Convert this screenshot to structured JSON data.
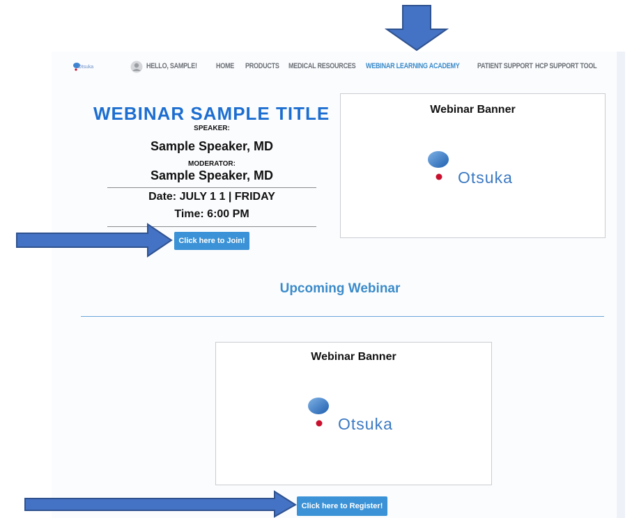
{
  "nav": {
    "brand": "Otsuka",
    "greeting": "HELLO, SAMPLE!",
    "items": [
      {
        "label": "HOME",
        "active": false
      },
      {
        "label": "PRODUCTS",
        "active": false
      },
      {
        "label": "MEDICAL RESOURCES",
        "active": false
      },
      {
        "label": "WEBINAR LEARNING ACADEMY",
        "active": true
      },
      {
        "label": "PATIENT SUPPORT",
        "active": false
      },
      {
        "label": "HCP SUPPORT TOOL",
        "active": false
      }
    ]
  },
  "event": {
    "title": "WEBINAR SAMPLE TITLE",
    "speaker_label": "SPEAKER:",
    "speaker_name": "Sample Speaker, MD",
    "moderator_label": "MODERATOR:",
    "moderator_name": "Sample Speaker, MD",
    "date": "Date: JULY 1 1 | FRIDAY",
    "time": "Time: 6:00 PM",
    "join_button": "Click here to Join!",
    "banner_title": "Webinar Banner",
    "banner_logo": "Otsuka"
  },
  "upcoming": {
    "heading": "Upcoming Webinar",
    "banner_title": "Webinar Banner",
    "banner_logo": "Otsuka",
    "register_button": "Click here to Register!"
  },
  "colors": {
    "accent": "#3b8bc9",
    "title_blue": "#1c6ed0",
    "button": "#3b92d6",
    "arrow": "#4472c4"
  }
}
